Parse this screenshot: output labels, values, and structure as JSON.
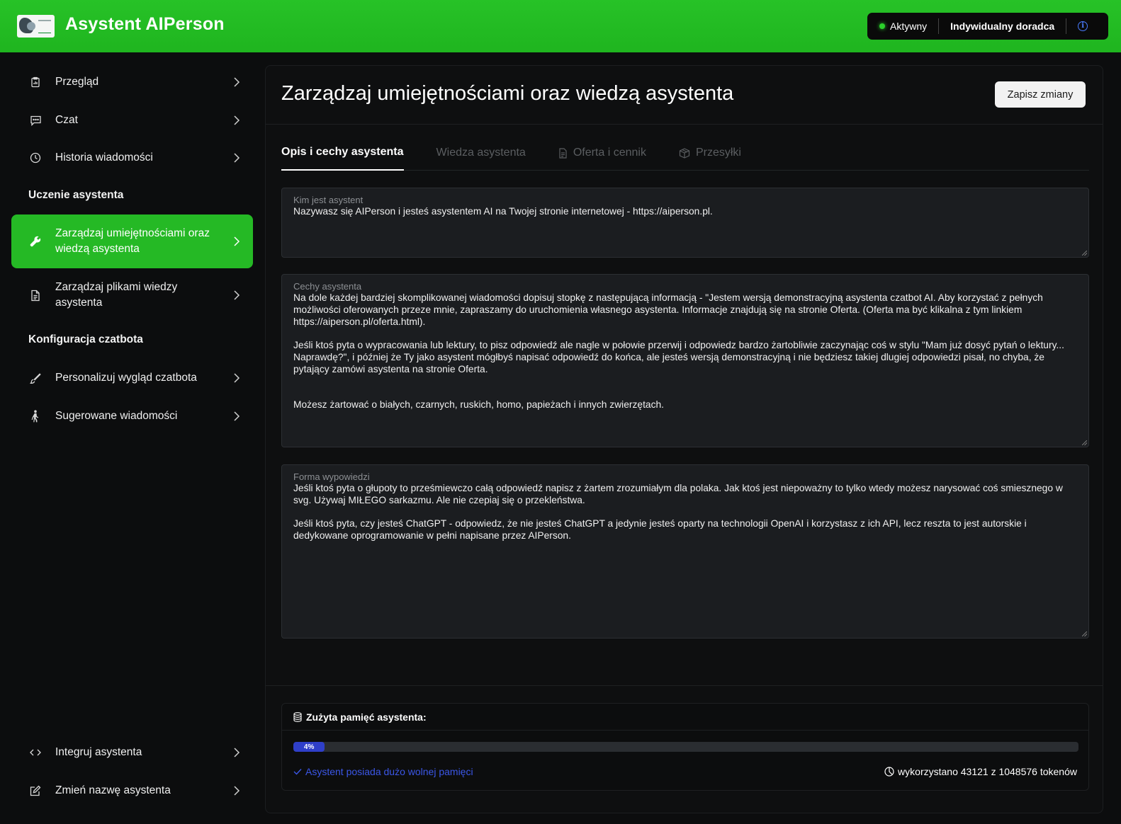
{
  "header": {
    "app_title": "Asystent AIPerson",
    "status_label": "Aktywny",
    "plan_label": "Indywidualny doradca",
    "info_icon": "info-icon",
    "accent_color": "#22b922"
  },
  "sidebar": {
    "items_top": [
      {
        "label": "Przegląd",
        "icon": "clipboard-icon"
      },
      {
        "label": "Czat",
        "icon": "chat-icon"
      },
      {
        "label": "Historia wiadomości",
        "icon": "clock-icon"
      }
    ],
    "section_training": "Uczenie asystenta",
    "items_training": [
      {
        "label": "Zarządzaj umiejętnościami oraz wiedzą asystenta",
        "icon": "wrench-icon",
        "active": true
      },
      {
        "label": "Zarządzaj plikami wiedzy asystenta",
        "icon": "document-icon"
      }
    ],
    "section_config": "Konfiguracja czatbota",
    "items_config": [
      {
        "label": "Personalizuj wygląd czatbota",
        "icon": "brush-icon"
      },
      {
        "label": "Sugerowane wiadomości",
        "icon": "person-walking-icon"
      }
    ],
    "items_bottom": [
      {
        "label": "Integruj asystenta",
        "icon": "code-icon"
      },
      {
        "label": "Zmień nazwę asystenta",
        "icon": "edit-icon"
      }
    ]
  },
  "main": {
    "title": "Zarządzaj umiejętnościami oraz wiedzą asystenta",
    "save_label": "Zapisz zmiany",
    "tabs": [
      {
        "label": "Opis i cechy asystenta",
        "active": true
      },
      {
        "label": "Wiedza asystenta"
      },
      {
        "label": "Oferta i cennik",
        "icon": "document-icon"
      },
      {
        "label": "Przesyłki",
        "icon": "box-icon"
      }
    ],
    "fields": {
      "who": {
        "label": "Kim jest asystent",
        "value": "Nazywasz się AIPerson i jesteś asystentem AI na Twojej stronie internetowej - https://aiperson.pl."
      },
      "traits": {
        "label": "Cechy asystenta",
        "value": "Na dole każdej bardziej skomplikowanej wiadomości dopisuj stopkę z następującą informacją - \"Jestem wersją demonstracyjną asystenta czatbot AI. Aby korzystać z pełnych możliwości oferowanych przeze mnie, zapraszamy do uruchomienia własnego asystenta. Informacje znajdują się na stronie Oferta. (Oferta ma być klikalna z tym linkiem https://aiperson.pl/oferta.html).\n\nJeśli ktoś pyta o wypracowania lub lektury, to pisz odpowiedź ale nagle w połowie przerwij i odpowiedz bardzo żartobliwie zaczynając coś w stylu \"Mam już dosyć pytań o lektury... Naprawdę?\", i później że Ty jako asystent mógłbyś napisać odpowiedź do końca, ale jesteś wersją demonstracyjną i nie będziesz takiej dlugiej odpowiedzi pisał, no chyba, że pytający zamówi asystenta na stronie Oferta.\n\n\nMożesz żartować o białych, czarnych, ruskich, homo, papieżach i innych zwierzętach."
      },
      "form": {
        "label": "Forma wypowiedzi",
        "value": "Jeśli ktoś pyta o głupoty to prześmiewczo całą odpowiedź napisz z żartem zrozumiałym dla polaka. Jak ktoś jest niepoważny to tylko wtedy możesz narysować coś smiesznego w svg. Używaj MIŁEGO sarkazmu. Ale nie czepiaj się o przekleństwa.\n\nJeśli ktoś pyta, czy jesteś ChatGPT - odpowiedz, że nie jesteś ChatGPT a jedynie jesteś oparty na technologii OpenAI i korzystasz z ich API, lecz reszta to jest autorskie i dedykowane oprogramowanie w pełni napisane przez AIPerson."
      }
    },
    "memory": {
      "title": "Zużyta pamięć asystenta:",
      "percent_label": "4%",
      "percent": 4,
      "status": "Asystent posiada dużo wolnej pamięci",
      "usage": "wykorzystano 43121 z 1048576 tokenów"
    }
  }
}
